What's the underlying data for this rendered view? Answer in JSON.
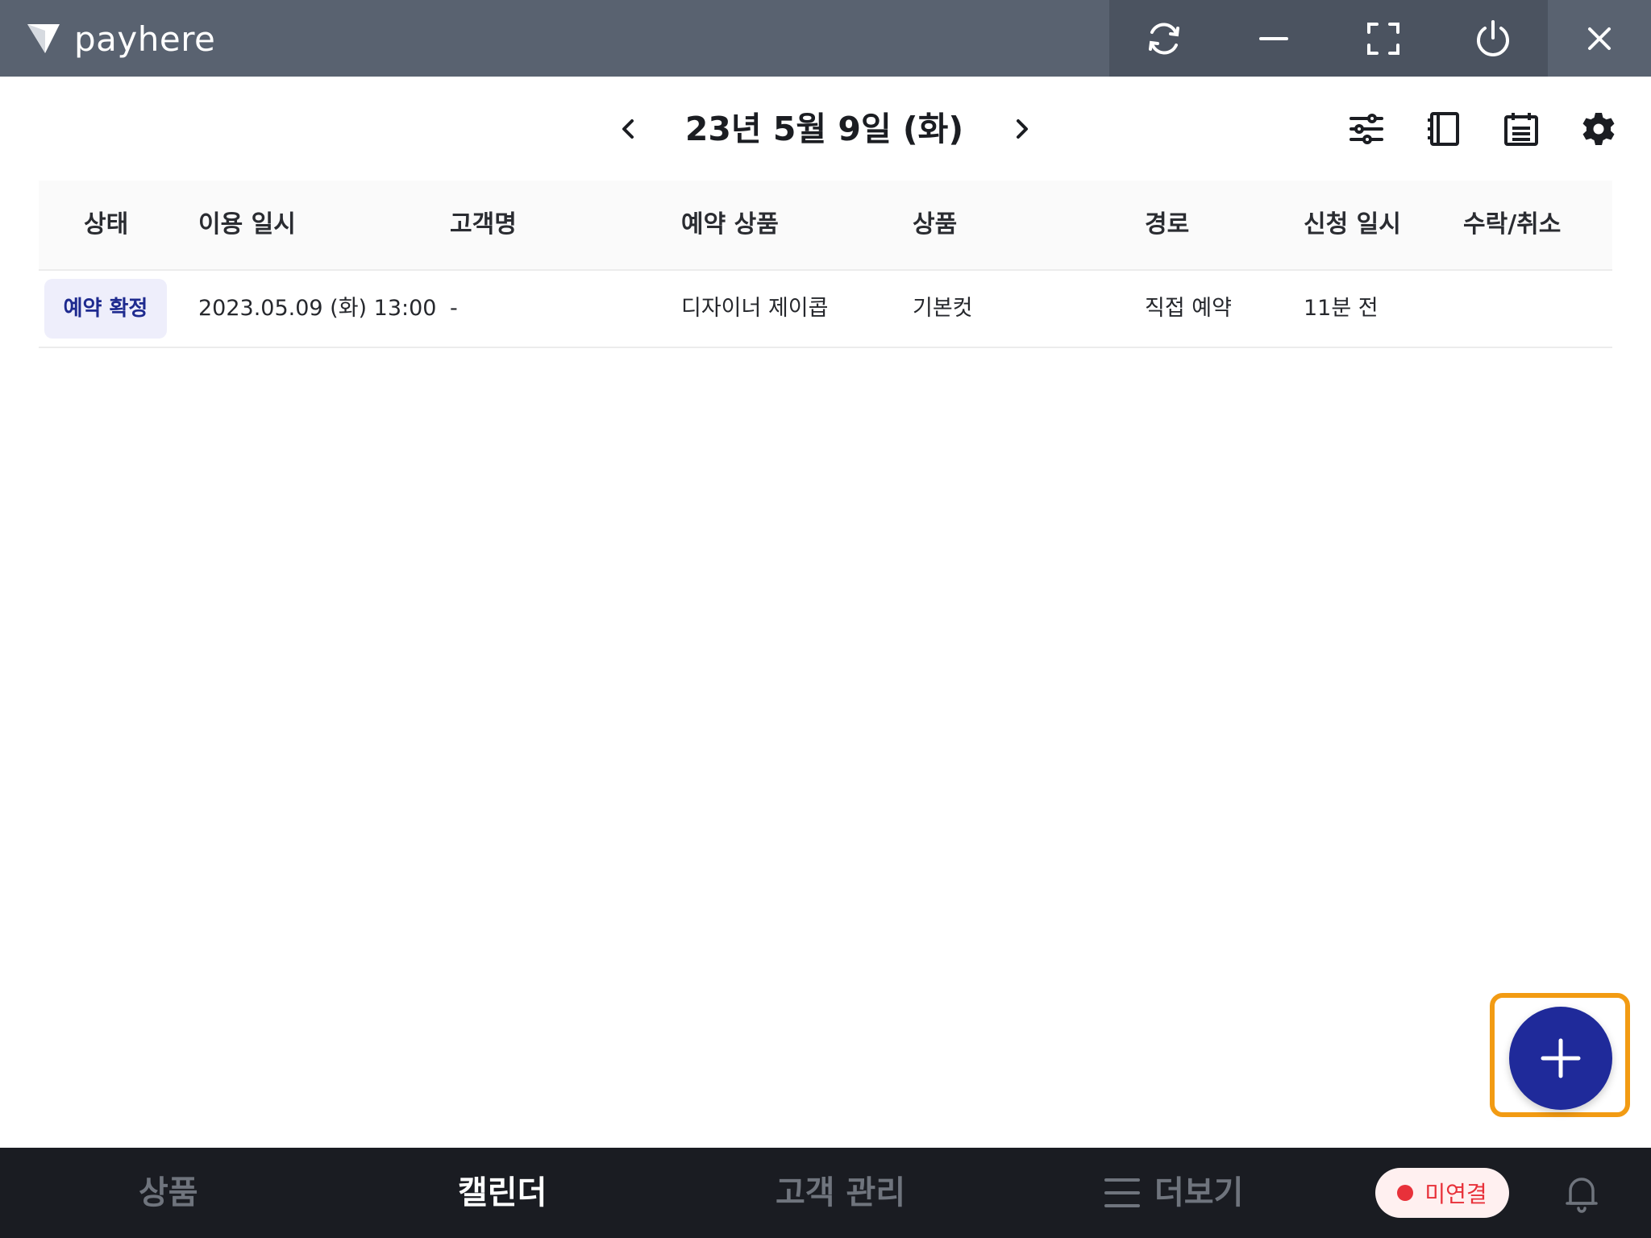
{
  "titlebar": {
    "brand_name": "payhere",
    "icons": [
      "refresh-icon",
      "minimize-icon",
      "fullscreen-icon",
      "power-icon",
      "close-icon"
    ]
  },
  "header": {
    "date_title": "23년 5월 9일 (화)",
    "prev_icon": "chevron-left-icon",
    "next_icon": "chevron-right-icon",
    "tools": [
      "filter-sliders-icon",
      "notebook-icon",
      "calendar-list-icon",
      "settings-gear-icon"
    ]
  },
  "table": {
    "headers": [
      "상태",
      "이용 일시",
      "고객명",
      "예약 상품",
      "상품",
      "경로",
      "신청 일시",
      "수락/취소"
    ],
    "rows": [
      {
        "status": "예약 확정",
        "use_datetime": "2023.05.09 (화) 13:00",
        "customer": "-",
        "reserved_product": "디자이너 제이콥",
        "product": "기본컷",
        "route": "직접 예약",
        "requested": "11분 전",
        "accept_cancel": ""
      }
    ]
  },
  "fab": {
    "icon": "plus-icon"
  },
  "bottom_nav": {
    "items": [
      "상품",
      "캘린더",
      "고객 관리",
      "더보기"
    ],
    "active": "캘린더",
    "connection_status": "미연결",
    "bell_icon": "bell-icon"
  },
  "colors": {
    "titlebar": "#596270",
    "accent": "#1f2a9a",
    "badge_bg": "#eeeefb",
    "highlight": "#f29b13",
    "error": "#e8313a"
  }
}
